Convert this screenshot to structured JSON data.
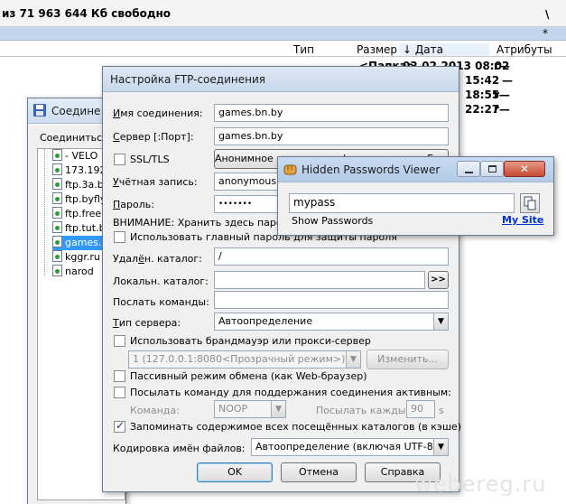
{
  "file_manager": {
    "free_space": "из 71 963 644 Кб свободно",
    "separator": "\\",
    "path_star": "*",
    "columns": {
      "type": "Тип",
      "size": "Размер",
      "date": "Дата",
      "date_arrow": "↓",
      "attrs": "Атрибуты"
    },
    "rows": [
      {
        "type": "<Папка>",
        "date": "02.02.2013 08:02",
        "attr": "r—"
      },
      {
        "type": "",
        "date": "15:42",
        "attr": "—"
      },
      {
        "type": "",
        "date": "18:55",
        "attr": "r—"
      },
      {
        "type": "",
        "date": "22:27",
        "attr": "r—"
      }
    ]
  },
  "connect_window": {
    "title": "Соедине",
    "label": "Соединиться",
    "items": [
      "- VELO",
      "173.192",
      "ftp.3a.b",
      "ftp.byfly",
      "ftp.freel",
      "ftp.tut.b",
      "games.",
      "kggr.ru",
      "narod"
    ],
    "selected_index": 6
  },
  "ftp_dialog": {
    "title": "Настройка FTP-соединения",
    "conn_name_label": "Имя соединения:",
    "conn_name_value": "games.bn.by",
    "server_label": "Сервер [:Порт]:",
    "server_value": "games.bn.by",
    "ssl_label": "SSL/TLS",
    "anon_button": "Анонимное соединение (пароль - адрес E-mail)",
    "user_label": "Учётная запись:",
    "user_value": "anonymous",
    "password_label": "Пароль:",
    "password_value": "•••••••",
    "warning": "ВНИМАНИЕ: Хранить здесь пароль",
    "master_pass_label": "Использовать главный пароль для защиты пароля",
    "remote_dir_label": "Удалён. каталог:",
    "remote_dir_value": "/",
    "local_dir_label": "Локальн. каталог:",
    "local_dir_value": "",
    "browse_label": ">>",
    "send_cmd_label": "Послать команды:",
    "send_cmd_value": "",
    "server_type_label": "Тип сервера:",
    "server_type_value": "Автоопределение",
    "firewall_label": "Использовать брандмауэр или прокси-сервер",
    "firewall_value": "1 (127.0.0.1:8080<Прозрачный режим>)",
    "firewall_change": "Изменить...",
    "passive_label": "Пассивный режим обмена (как Web-браузер)",
    "keepalive_label": "Посылать команду для поддержания соединения активным:",
    "command_label": "Команда:",
    "command_value": "NOOP",
    "interval_label": "Посылать каждые:",
    "interval_value": "90",
    "interval_unit": "s",
    "remember_label": "Запоминать содержимое всех посещённых каталогов (в кэше)",
    "encoding_label": "Кодировка имён файлов:",
    "encoding_value": "Автоопределение (включая UTF-8)",
    "ok": "OK",
    "cancel": "Отмена",
    "help": "Справка"
  },
  "hpv_window": {
    "title": "Hidden Passwords Viewer",
    "password": "mypass",
    "show_label": "Show Passwords",
    "site_link": "My Site"
  },
  "watermark": "webereg.ru",
  "colors": {
    "selection": "#3399ff",
    "link": "#0033cc",
    "path_bar": "#c2d6ee"
  }
}
